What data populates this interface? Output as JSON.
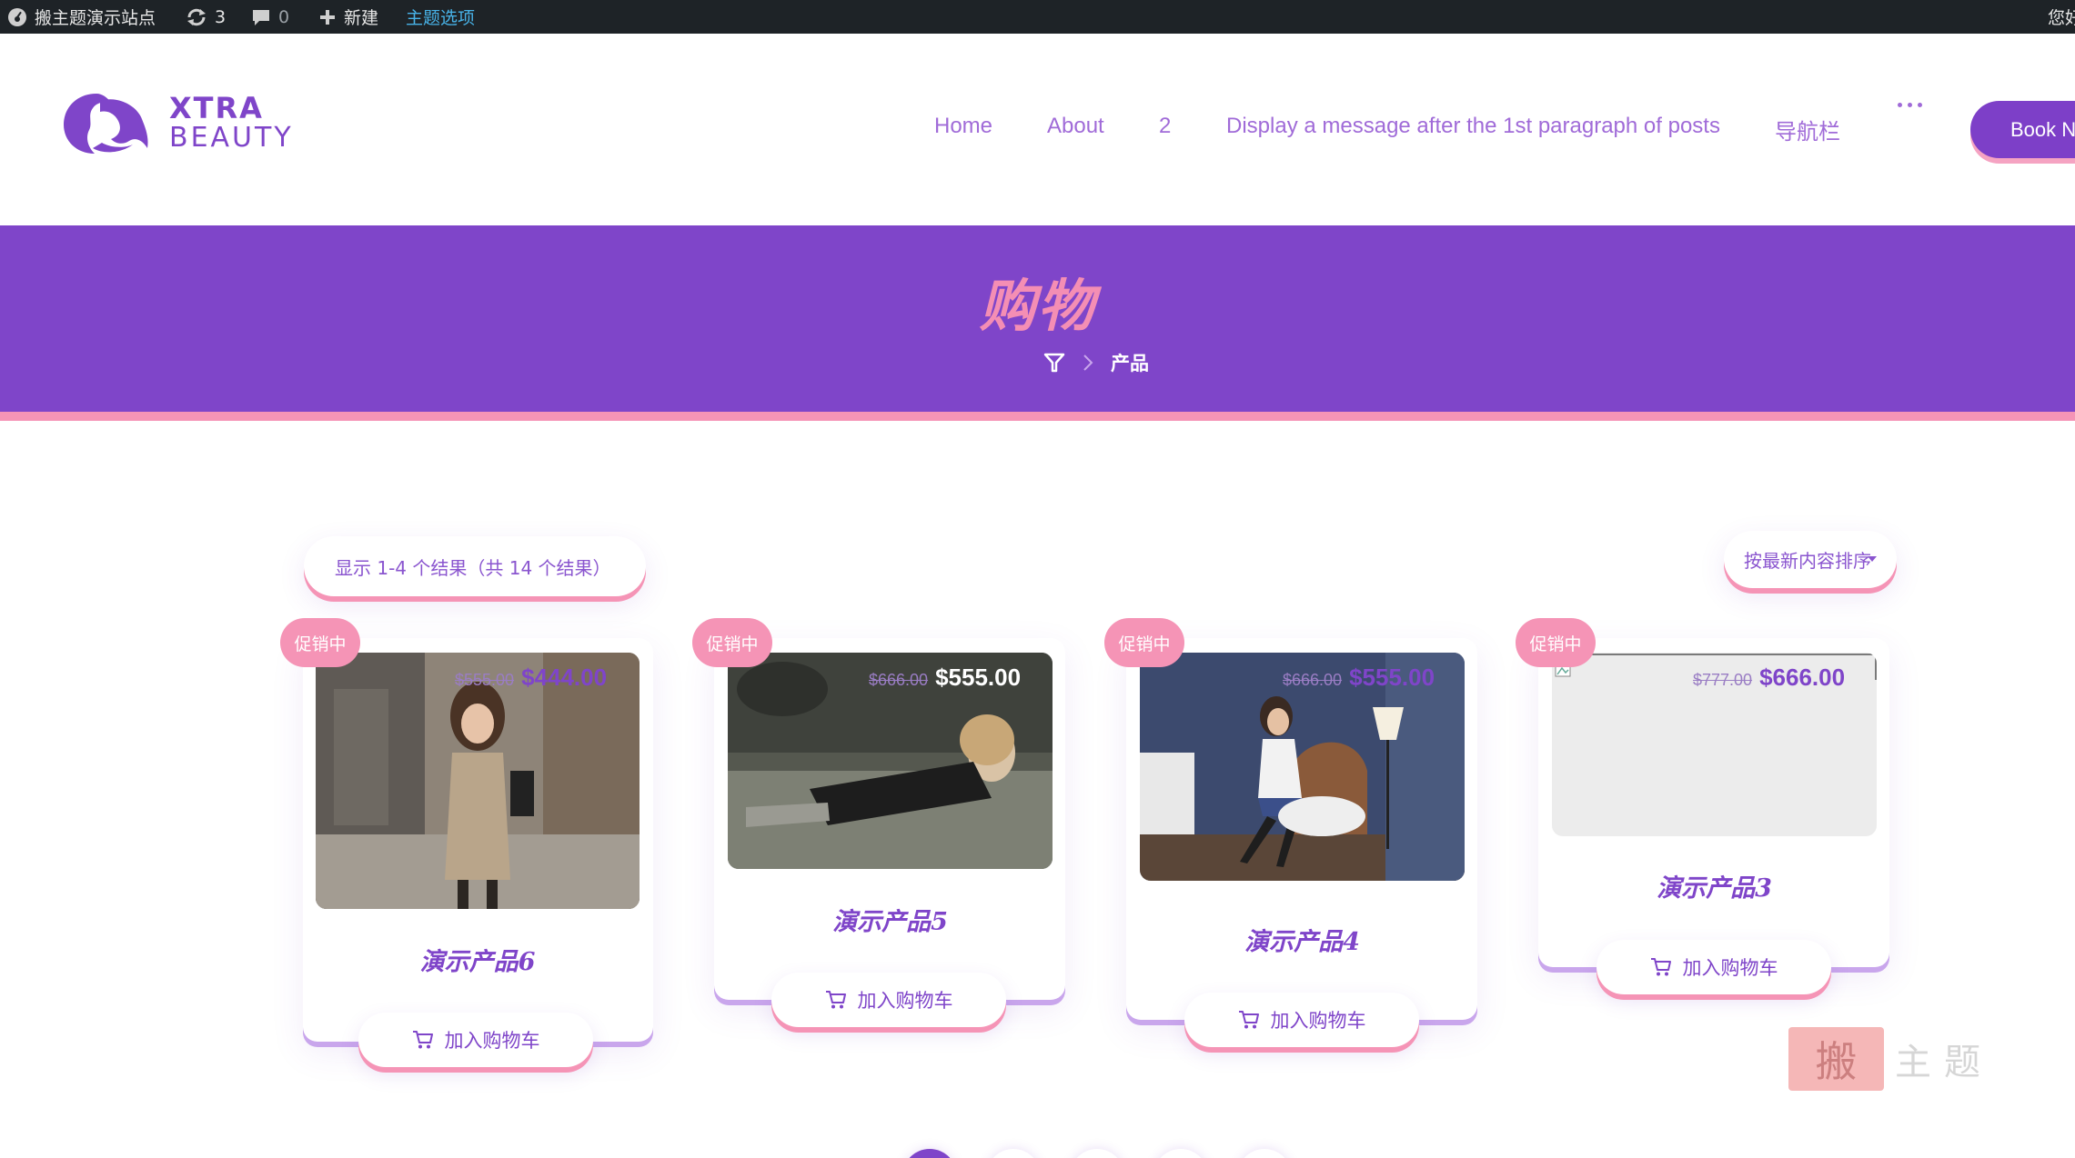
{
  "adminbar": {
    "site_name": "搬主题演示站点",
    "updates_count": "3",
    "comments_count": "0",
    "new_label": "新建",
    "theme_options_label": "主题选项",
    "greeting": "您好"
  },
  "header": {
    "logo_line1": "XTRA",
    "logo_line2": "BEAUTY",
    "nav": [
      "Home",
      "About",
      "2",
      "Display a message after the 1st paragraph of posts",
      "导航栏"
    ],
    "book_label": "Book Now"
  },
  "hero": {
    "title": "购物",
    "breadcrumb_current": "产品"
  },
  "shop": {
    "result_count": "显示 1-4 个结果（共 14 个结果）",
    "sort_label": "按最新内容排序"
  },
  "products": [
    {
      "sale": "促销中",
      "old_price": "$555.00",
      "price": "$444.00",
      "title": "演示产品6",
      "cart_label": "加入购物车"
    },
    {
      "sale": "促销中",
      "old_price": "$666.00",
      "price": "$555.00",
      "title": "演示产品5",
      "cart_label": "加入购物车"
    },
    {
      "sale": "促销中",
      "old_price": "$666.00",
      "price": "$555.00",
      "title": "演示产品4",
      "cart_label": "加入购物车"
    },
    {
      "sale": "促销中",
      "old_price": "$777.00",
      "price": "$666.00",
      "title": "演示产品3",
      "cart_label": "加入购物车"
    }
  ],
  "watermark": {
    "text": "主题",
    "box_char": "搬"
  },
  "colors": {
    "purple": "#7f45c9",
    "pink": "#f594b6",
    "adminbar": "#1e2327"
  }
}
